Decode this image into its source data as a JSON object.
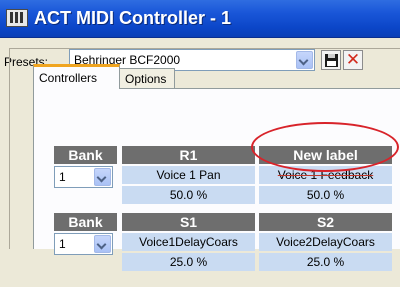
{
  "window": {
    "title": "ACT MIDI Controller - 1",
    "icon": "midi-keyboard-icon"
  },
  "presets": {
    "label": "Presets:",
    "selected": "Behringer BCF2000",
    "save_icon": "floppy-disk-icon",
    "delete_icon": "red-x-icon",
    "delete_glyph": "✕"
  },
  "tabs": [
    {
      "label": "Controllers",
      "active": true
    },
    {
      "label": "Options",
      "active": false
    }
  ],
  "groups": [
    {
      "bank_header": "Bank",
      "bank_value": "1",
      "controls": [
        {
          "header": "R1",
          "name": "Voice 1 Pan",
          "value": "50.0 %"
        },
        {
          "header": "New label",
          "name": "Voice 1 Feedback",
          "value": "50.0 %"
        }
      ]
    },
    {
      "bank_header": "Bank",
      "bank_value": "1",
      "controls": [
        {
          "header": "S1",
          "name": "Voice1DelayCoars",
          "value": "25.0 %"
        },
        {
          "header": "S2",
          "name": "Voice2DelayCoars",
          "value": "25.0 %"
        }
      ]
    }
  ],
  "annotation": {
    "shape": "ellipse",
    "color": "#d8232a"
  },
  "colors": {
    "titlebar": "#0b46c8",
    "header_bg": "#6e6e6e",
    "cell_bg": "#c9dbf2",
    "tab_accent": "#f0a520"
  }
}
